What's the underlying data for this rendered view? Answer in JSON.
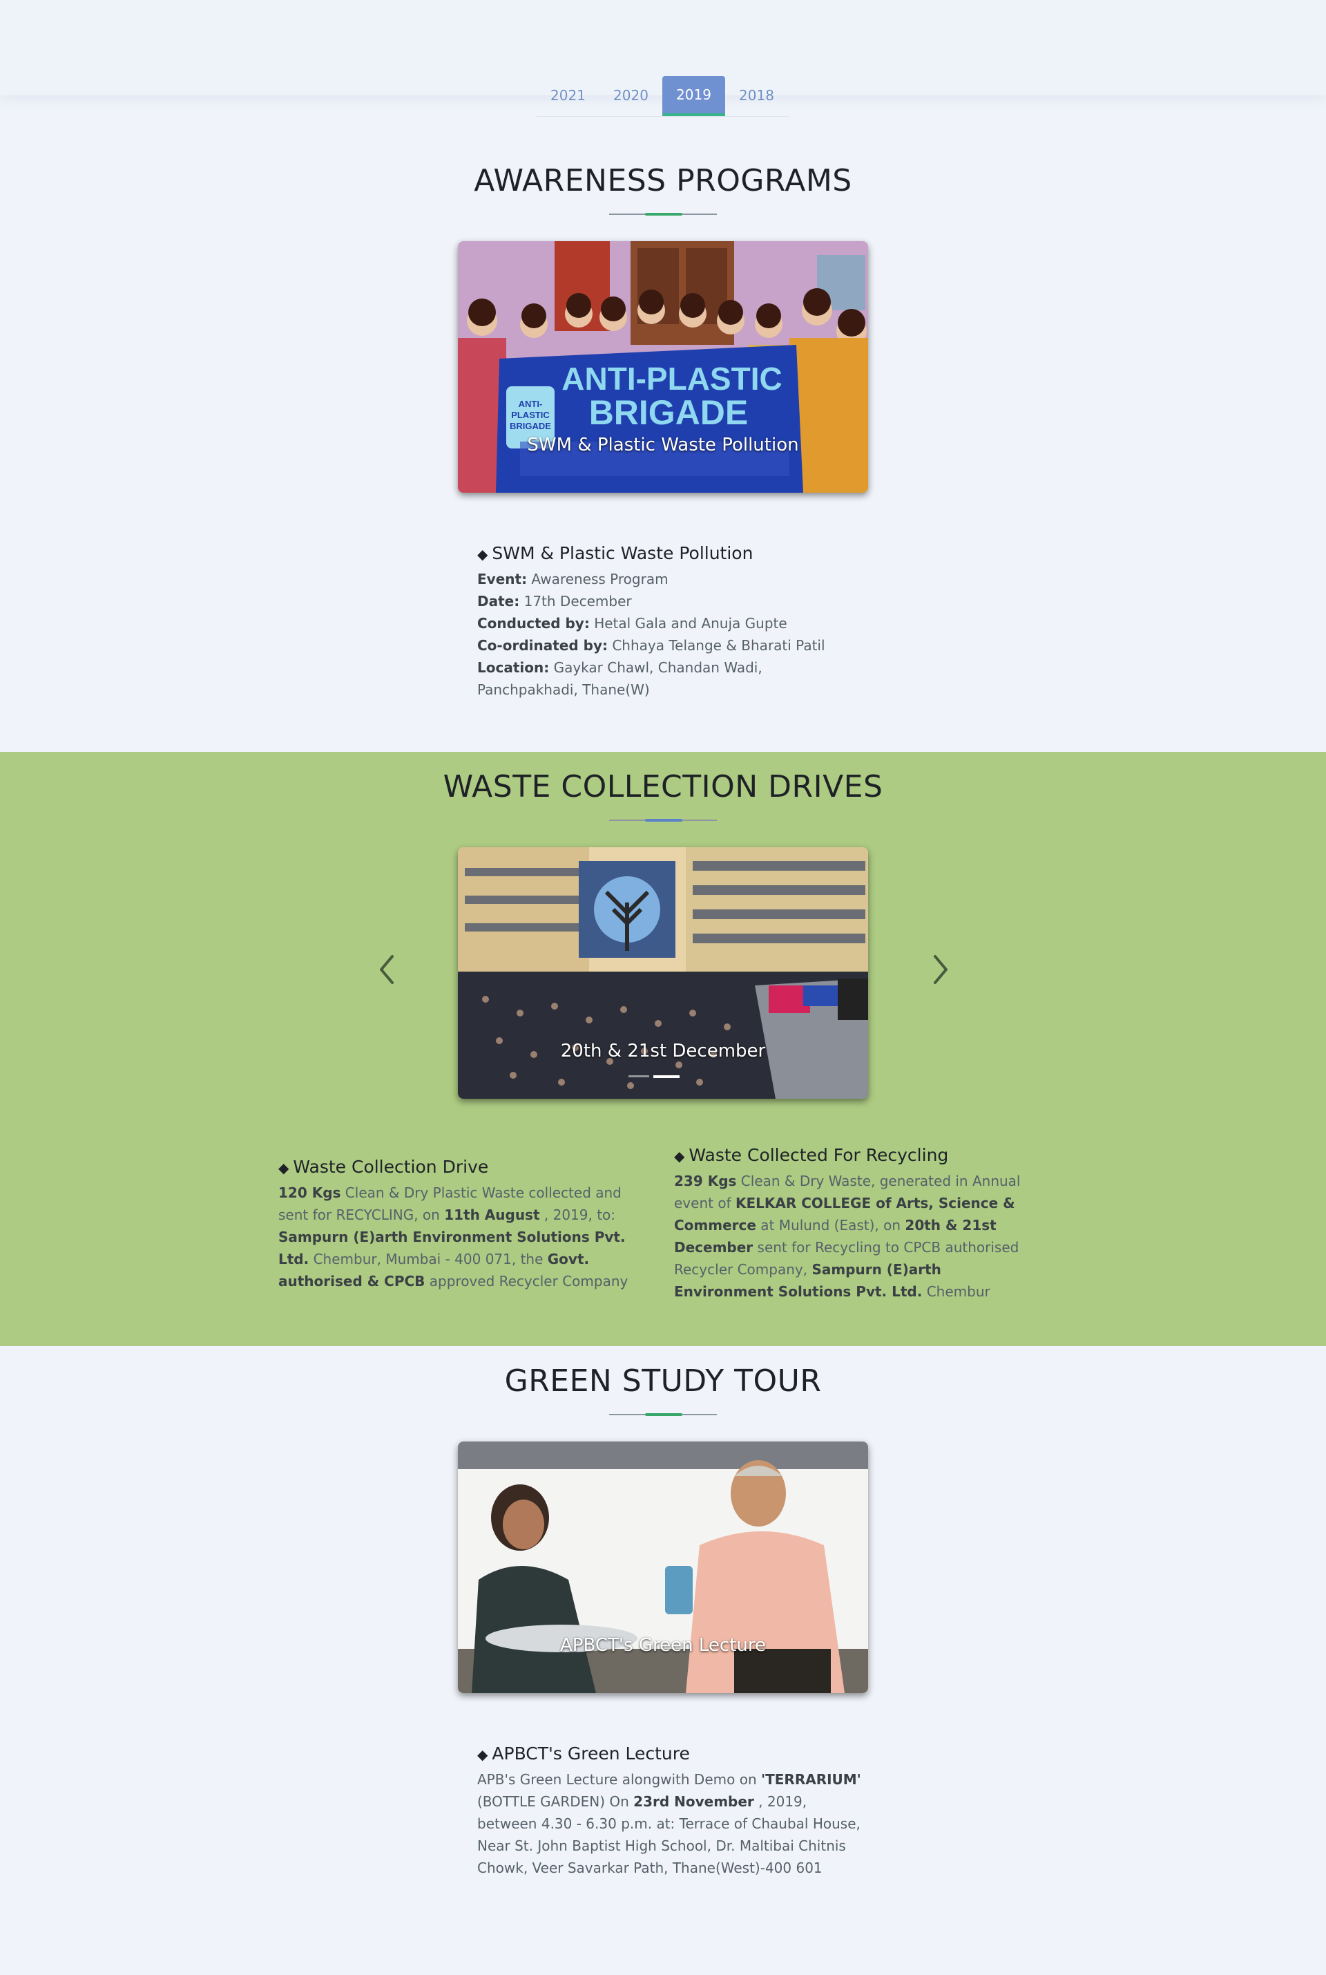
{
  "year_tabs": [
    "2021",
    "2020",
    "2019",
    "2018"
  ],
  "active_tab": "2019",
  "colors": {
    "accent_green": "#38a86a",
    "accent_blue": "#5b82c9",
    "tab_active": "#6f90d1",
    "band_green": "#adcb82"
  },
  "awareness": {
    "title": "AWARENESS PROGRAMS",
    "photo_caption": "SWM & Plastic Waste Pollution",
    "banner_text": [
      "ANTI-PLASTIC",
      "BRIGADE"
    ],
    "banner_logo": [
      "ANTI-",
      "PLASTIC",
      "BRIGADE"
    ],
    "item": {
      "heading": "SWM & Plastic Waste Pollution",
      "event_label": "Event:",
      "event": "Awareness Program",
      "date_label": "Date:",
      "date": "17th December",
      "conducted_label": "Conducted by:",
      "conducted": "Hetal Gala and Anuja Gupte",
      "coordinated_label": "Co-ordinated by:",
      "coordinated": "Chhaya Telange & Bharati Patil",
      "location_label": "Location:",
      "location": "Gaykar Chawl, Chandan Wadi, Panchpakhadi, Thane(W)"
    }
  },
  "waste": {
    "title": "WASTE COLLECTION DRIVES",
    "photo_caption": "20th & 21st December",
    "carousel_indicators": 2,
    "active_indicator": 1,
    "left_item": {
      "heading": "Waste Collection Drive",
      "p1": "120 Kgs",
      "p2": " Clean & Dry Plastic Waste collected and sent for RECYCLING, on ",
      "p3": "11th August",
      "p4": " , 2019, to: ",
      "p5": "Sampurn (E)arth Environment Solutions Pvt. Ltd.",
      "p6": " Chembur, Mumbai - 400 071, the ",
      "p7": "Govt. authorised & CPCB",
      "p8": " approved Recycler Company"
    },
    "right_item": {
      "heading": "Waste Collected For Recycling",
      "p1": "239 Kgs",
      "p2": " Clean & Dry Waste, generated in Annual event of ",
      "p3": "KELKAR COLLEGE of Arts, Science & Commerce",
      "p4": " at Mulund (East), on ",
      "p5": "20th & 21st December",
      "p6": " sent for Recycling to CPCB authorised Recycler Company, ",
      "p7": "Sampurn (E)arth Environment Solutions Pvt. Ltd.",
      "p8": " Chembur"
    }
  },
  "tour": {
    "title": "GREEN STUDY TOUR",
    "photo_caption": "APBCT's Green Lecture",
    "item": {
      "heading": "APBCT's Green Lecture",
      "p1": "APB's Green Lecture alongwith Demo on ",
      "p2": "'TERRARIUM'",
      "p3": " (BOTTLE GARDEN) On ",
      "p4": "23rd November",
      "p5": " , 2019, between 4.30 - 6.30 p.m. at: Terrace of Chaubal House, Near St. John Baptist High School, Dr. Maltibai Chitnis Chowk, Veer Savarkar Path, Thane(West)-400 601"
    }
  }
}
